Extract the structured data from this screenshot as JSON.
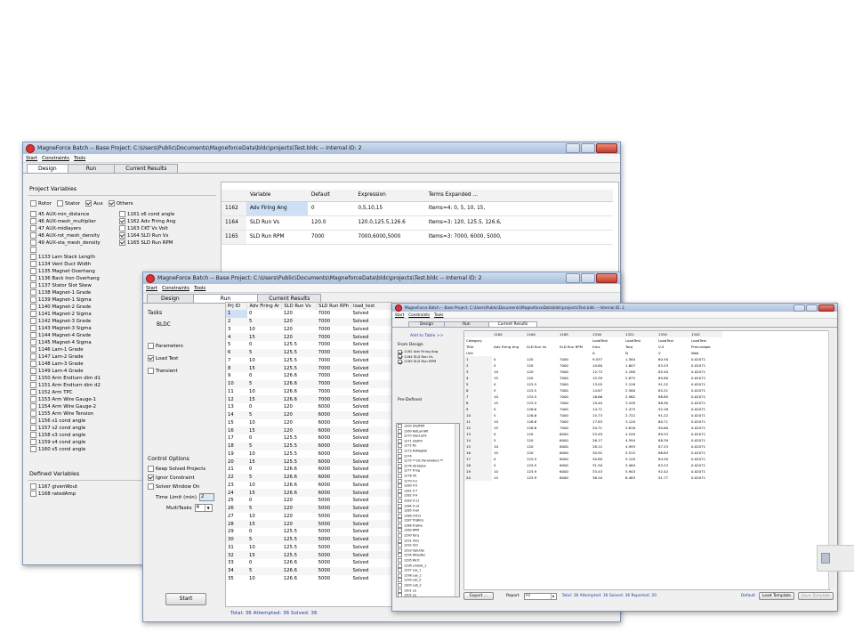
{
  "w1": {
    "title": "MagneForce Batch -- Base Project: C:\\Users\\Public\\Documents\\MagneforceData\\bldc\\projects\\Test.bldc -- Internal ID: 2",
    "menu": [
      "Start",
      "Constraints",
      "Tools"
    ],
    "tabs": [
      "Design",
      "Run",
      "Current Results"
    ],
    "project_variables_label": "Project Variables",
    "filters": [
      {
        "label": "Rotor",
        "checked": false
      },
      {
        "label": "Stator",
        "checked": false
      },
      {
        "label": "Aux",
        "checked": true
      },
      {
        "label": "Others",
        "checked": true
      }
    ],
    "vars_col1": [
      {
        "label": "45 AUX-min_distance",
        "checked": false
      },
      {
        "label": "46 AUX-mesh_multiplier",
        "checked": false
      },
      {
        "label": "47 AUX-midlayers",
        "checked": false
      },
      {
        "label": "48 AUX-rot_mesh_density",
        "checked": false
      },
      {
        "label": "49 AUX-sta_mesh_density",
        "checked": false
      }
    ],
    "vars_col2": [
      {
        "label": "1161 s6 cond angle",
        "checked": false
      },
      {
        "label": "1162 Adv Firing Ang",
        "checked": true
      },
      {
        "label": "1163 CKT Vs Volt",
        "checked": false
      },
      {
        "label": "1164 SLD Run Vs",
        "checked": true
      },
      {
        "label": "1165 SLD Run RPM",
        "checked": true
      }
    ],
    "vars_long": [
      "1133 Lam Stack Length",
      "1134 Vent Duct Width",
      "1135 Magnet Overhang",
      "1136 Back Iron Overhang",
      "1137 Stator Slot Skew",
      "1138 Magnet-1 Grade",
      "1139 Magnet-1 Sigma",
      "1140 Magnet-2 Grade",
      "1141 Magnet-2 Sigma",
      "1142 Magnet-3 Grade",
      "1143 Magnet-3 Sigma",
      "1144 Magnet-4 Grade",
      "1145 Magnet-4 Sigma",
      "1146 Lam-1 Grade",
      "1147 Lam-2 Grade",
      "1148 Lam-3 Grade",
      "1149 Lam-4 Grade",
      "1150 Arm Endturn dim d1",
      "1151 Arm Endturn dim d2",
      "1152 Arm TPC",
      "1153 Arm Wire Gauge-1",
      "1154 Arm Wire Gauge-2",
      "1155 Arm Wire Tension",
      "1156 s1 cond angle",
      "1157 s2 cond angle",
      "1158 s3 cond angle",
      "1159 s4 cond angle",
      "1160 s5 cond angle"
    ],
    "defined_label": "Defined Variables",
    "defined": [
      "1167 givenWout",
      "1168 ratedAmp"
    ],
    "table_headers": [
      "",
      "Variable",
      "Default",
      "Expression",
      "Terms Expanded ..."
    ],
    "table_rows": [
      [
        "1162",
        "Adv Firing Ang",
        "0",
        "0,5,10,15",
        "Items=4: 0, 5, 10, 15,"
      ],
      [
        "1164",
        "SLD Run Vs",
        "120.0",
        "120.0,125.5,126.6",
        "Items=3: 120, 125.5, 126.6,"
      ],
      [
        "1165",
        "SLD Run RPM",
        "7000",
        "7000,6000,5000",
        "Items=3: 7000, 6000, 5000,"
      ]
    ]
  },
  "w2": {
    "title": "MagneForce Batch -- Base Project: C:\\Users\\Public\\Documents\\MagneforceData\\bldc\\projects\\Test.bldc -- Internal ID: 2",
    "menu": [
      "Start",
      "Constraints",
      "Tools"
    ],
    "tabs": [
      "Design",
      "Run",
      "Current Results"
    ],
    "tasks_label": "Tasks",
    "tasks_value": "BLDC",
    "task_checks": [
      {
        "label": "Parameters",
        "checked": false
      },
      {
        "label": "Load Test",
        "checked": true
      },
      {
        "label": "Transient",
        "checked": false
      }
    ],
    "control_label": "Control Options",
    "control_checks": [
      {
        "label": "Keep Solved Projects",
        "checked": false
      },
      {
        "label": "Ignor Constraint",
        "checked": true
      },
      {
        "label": "Solver Window On",
        "checked": false
      }
    ],
    "time_limit_label": "Time Limit (min)",
    "time_limit_value": "2",
    "multitasks_label": "MultiTasks",
    "multitasks_value": "4",
    "start_label": "Start",
    "headers": [
      "Prj ID",
      "Adv Firing Ar",
      "SLD Run Vs",
      "SLD Run RPh",
      "load_test"
    ],
    "rows": [
      [
        "1",
        "0",
        "120",
        "7000",
        "Solved"
      ],
      [
        "2",
        "5",
        "120",
        "7000",
        "Solved"
      ],
      [
        "3",
        "10",
        "120",
        "7000",
        "Solved"
      ],
      [
        "4",
        "15",
        "120",
        "7000",
        "Solved"
      ],
      [
        "5",
        "0",
        "125.5",
        "7000",
        "Solved"
      ],
      [
        "6",
        "5",
        "125.5",
        "7000",
        "Solved"
      ],
      [
        "7",
        "10",
        "125.5",
        "7000",
        "Solved"
      ],
      [
        "8",
        "15",
        "125.5",
        "7000",
        "Solved"
      ],
      [
        "9",
        "0",
        "126.6",
        "7000",
        "Solved"
      ],
      [
        "10",
        "5",
        "126.6",
        "7000",
        "Solved"
      ],
      [
        "11",
        "10",
        "126.6",
        "7000",
        "Solved"
      ],
      [
        "12",
        "15",
        "126.6",
        "7000",
        "Solved"
      ],
      [
        "13",
        "0",
        "120",
        "6000",
        "Solved"
      ],
      [
        "14",
        "5",
        "120",
        "6000",
        "Solved"
      ],
      [
        "15",
        "10",
        "120",
        "6000",
        "Solved"
      ],
      [
        "16",
        "15",
        "120",
        "6000",
        "Solved"
      ],
      [
        "17",
        "0",
        "125.5",
        "6000",
        "Solved"
      ],
      [
        "18",
        "5",
        "125.5",
        "6000",
        "Solved"
      ],
      [
        "19",
        "10",
        "125.5",
        "6000",
        "Solved"
      ],
      [
        "20",
        "15",
        "125.5",
        "6000",
        "Solved"
      ],
      [
        "21",
        "0",
        "126.6",
        "6000",
        "Solved"
      ],
      [
        "22",
        "5",
        "126.6",
        "6000",
        "Solved"
      ],
      [
        "23",
        "10",
        "126.6",
        "6000",
        "Solved"
      ],
      [
        "24",
        "15",
        "126.6",
        "6000",
        "Solved"
      ],
      [
        "25",
        "0",
        "120",
        "5000",
        "Solved"
      ],
      [
        "26",
        "5",
        "120",
        "5000",
        "Solved"
      ],
      [
        "27",
        "10",
        "120",
        "5000",
        "Solved"
      ],
      [
        "28",
        "15",
        "120",
        "5000",
        "Solved"
      ],
      [
        "29",
        "0",
        "125.5",
        "5000",
        "Solved"
      ],
      [
        "30",
        "5",
        "125.5",
        "5000",
        "Solved"
      ],
      [
        "31",
        "10",
        "125.5",
        "5000",
        "Solved"
      ],
      [
        "32",
        "15",
        "125.5",
        "5000",
        "Solved"
      ],
      [
        "33",
        "0",
        "126.6",
        "5000",
        "Solved"
      ],
      [
        "34",
        "5",
        "126.6",
        "5000",
        "Solved"
      ],
      [
        "35",
        "10",
        "126.6",
        "5000",
        "Solved"
      ]
    ],
    "status": "Total: 36   Attempted: 36   Solved: 36"
  },
  "w3": {
    "title": "MagneForce Batch -- Base Project: C:\\Users\\Public\\Documents\\MagneforceData\\bldc\\projects\\Test.bldc -- Internal ID: 2",
    "menu": [
      "Start",
      "Constraints",
      "Tools"
    ],
    "tabs": [
      "Design",
      "Run",
      "Current Results"
    ],
    "add_to_table": "Add to Table >>",
    "from_design_label": "From Design",
    "from_design": [
      "1162 Adv Firing Ang",
      "1164 SLD Run Vs",
      "1165 SLD Run RPM"
    ],
    "predefined_label": "Pre-Defined",
    "predefined": [
      "1200 ShaftWt",
      "1269 RotLamWt",
      "1270 StacLamt",
      "1271 SlotFill",
      "1272 Rs",
      "1273 RsMagVol",
      "1274",
      "1275 ** DC Parameters **",
      "1276 StrStator",
      "1277 Fring",
      "1278 V0",
      "1279 V-2",
      "1280 V-5",
      "1281 V-7",
      "1282 V-9",
      "1283 V-11",
      "1284 V-13",
      "1285 V-all",
      "1286 V-thd",
      "1287 TrqRms",
      "1288 TrqAve",
      "1289 RPM",
      "1290 Torq",
      "1291 Vms",
      "1292 Vrcl",
      "1293 Vph/dia",
      "1294 Wire/Rel",
      "1295 Wcrt",
      "1296 Lm/Set_1",
      "1297 Lsa_1",
      "1298 Laa_2",
      "1299 Lsb_0",
      "1300 Lab_2",
      "1301 Ld",
      "1302 Lq",
      "1403 T_pk",
      "1304 T_1"
    ],
    "col_ids": [
      "",
      "1162",
      "1164",
      "1165",
      "1316",
      "1321",
      "1334",
      "1342"
    ],
    "category": [
      "Category",
      "",
      "",
      "",
      "LoadTest",
      "LoadTest",
      "LoadTest",
      "LoadTest"
    ],
    "title_row": [
      "Title",
      "Adv Firing Ang",
      "SLD Run Vs",
      "SLD Run RPM",
      "Irms",
      "Torq",
      "V-S",
      "PmLmdapk"
    ],
    "unit_row": [
      "Unit",
      "",
      "",
      "",
      "A",
      "N",
      "V",
      "Web"
    ],
    "rows": [
      [
        "1",
        "0",
        "120",
        "7000",
        "9.537",
        "1.584",
        "80.50",
        "0.02071"
      ],
      [
        "2",
        "5",
        "120",
        "7000",
        "10.60",
        "1.607",
        "83.53",
        "0.02071"
      ],
      [
        "3",
        "10",
        "120",
        "7000",
        "12.72",
        "2.180",
        "85.40",
        "0.02071"
      ],
      [
        "4",
        "15",
        "120",
        "7000",
        "15.39",
        "2.675",
        "89.80",
        "0.02071"
      ],
      [
        "5",
        "0",
        "125.5",
        "7000",
        "13.05",
        "2.126",
        "91.22",
        "0.02071"
      ],
      [
        "6",
        "5",
        "125.5",
        "7000",
        "14.87",
        "2.560",
        "85.21",
        "0.02071"
      ],
      [
        "7",
        "10",
        "125.5",
        "7000",
        "16.86",
        "2.962",
        "88.85",
        "0.02071"
      ],
      [
        "8",
        "15",
        "125.5",
        "7000",
        "19.40",
        "3.439",
        "88.90",
        "0.02071"
      ],
      [
        "9",
        "0",
        "126.6",
        "7000",
        "14.71",
        "2.475",
        "92.26",
        "0.02071"
      ],
      [
        "10",
        "5",
        "126.6",
        "7000",
        "15.73",
        "2.722",
        "91.22",
        "0.02071"
      ],
      [
        "11",
        "10",
        "126.6",
        "7000",
        "17.83",
        "3.120",
        "80.71",
        "0.02071"
      ],
      [
        "12",
        "15",
        "126.6",
        "7000",
        "20.71",
        "3.618",
        "90.60",
        "0.02071"
      ],
      [
        "13",
        "0",
        "120",
        "6000",
        "25.49",
        "4.249",
        "89.53",
        "0.02071"
      ],
      [
        "14",
        "5",
        "120",
        "6000",
        "26.17",
        "4.594",
        "88.39",
        "0.02071"
      ],
      [
        "15",
        "10",
        "120",
        "6000",
        "28.12",
        "4.993",
        "87.23",
        "0.02071"
      ],
      [
        "16",
        "15",
        "120",
        "6000",
        "30.92",
        "5.515",
        "86.63",
        "0.02071"
      ],
      [
        "17",
        "0",
        "125.5",
        "6000",
        "30.80",
        "5.120",
        "84.50",
        "0.02071"
      ],
      [
        "18",
        "5",
        "125.5",
        "6000",
        "31.50",
        "5.464",
        "83.23",
        "0.02071"
      ],
      [
        "19",
        "10",
        "125.9",
        "6000",
        "33.43",
        "5.903",
        "92.42",
        "0.02071"
      ],
      [
        "20",
        "15",
        "125.9",
        "6000",
        "36.20",
        "6.483",
        "91.77",
        "0.02071"
      ]
    ],
    "export_label": "Export ...",
    "report_label": "Report",
    "report_value": "All",
    "status": "Total: 36   Attempted: 36   Solved: 36   Reported: 20",
    "default_label": "Default",
    "load_template_label": "Load Template",
    "save_template_label": "Save Template"
  }
}
